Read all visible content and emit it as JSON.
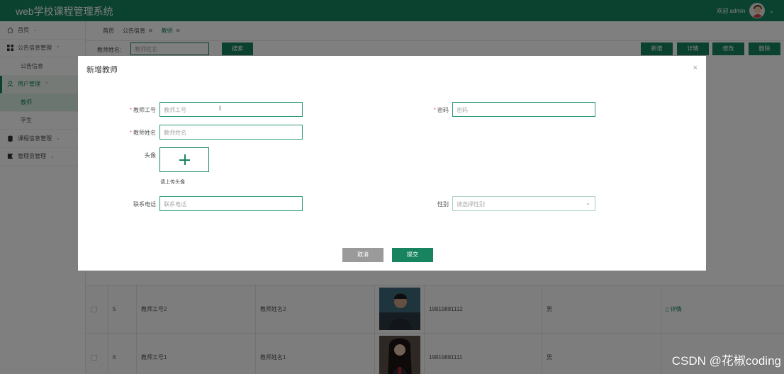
{
  "app": {
    "title": "web学校课程管理系统"
  },
  "user": {
    "greeting": "欢迎 admin",
    "dropdown": "⌄"
  },
  "sidebar": {
    "items": [
      {
        "label": "首页",
        "chevron": "⌄"
      },
      {
        "label": "公告信息管理",
        "chevron": "⌃"
      },
      {
        "label": "公告信息"
      },
      {
        "label": "用户管理",
        "chevron": "⌃"
      },
      {
        "label": "教师"
      },
      {
        "label": "学生"
      },
      {
        "label": "课程信息管理",
        "chevron": "⌄"
      },
      {
        "label": "管理员管理",
        "chevron": "⌄"
      }
    ]
  },
  "tabs": [
    {
      "label": "首页"
    },
    {
      "label": "公告信息",
      "close": "✕"
    },
    {
      "label": "教师",
      "close": "✕"
    }
  ],
  "toolbar": {
    "search_label": "教师姓名:",
    "search_placeholder": "教师姓名",
    "search_button": "搜索",
    "add": "新增",
    "detail": "详情",
    "edit": "修改",
    "delete": "删除"
  },
  "table": {
    "rows": [
      {
        "index": "5",
        "teacher_no": "教师工号2",
        "teacher_name": "教师姓名2",
        "phone": "19819881112",
        "gender": "男",
        "action": "详情"
      },
      {
        "index": "6",
        "teacher_no": "教师工号1",
        "teacher_name": "教师姓名1",
        "phone": "19819881111",
        "gender": "男",
        "action": "详情"
      }
    ]
  },
  "dialog": {
    "title": "新增教师",
    "close": "×",
    "required_mark": "*",
    "teacher_no_label": "教师工号",
    "teacher_no_placeholder": "教师工号",
    "password_label": "密码",
    "password_placeholder": "密码",
    "teacher_name_label": "教师姓名",
    "teacher_name_placeholder": "教师姓名",
    "avatar_label": "头像",
    "avatar_hint": "请上传头像",
    "phone_label": "联系电话",
    "phone_placeholder": "联系电话",
    "gender_label": "性别",
    "gender_placeholder": "请选择性别",
    "cancel": "取消",
    "submit": "提交"
  },
  "watermark": "CSDN @花椒coding",
  "colors": {
    "primary": "#17845f",
    "cancel_gray": "#9a9a9a",
    "required": "#e06060"
  }
}
